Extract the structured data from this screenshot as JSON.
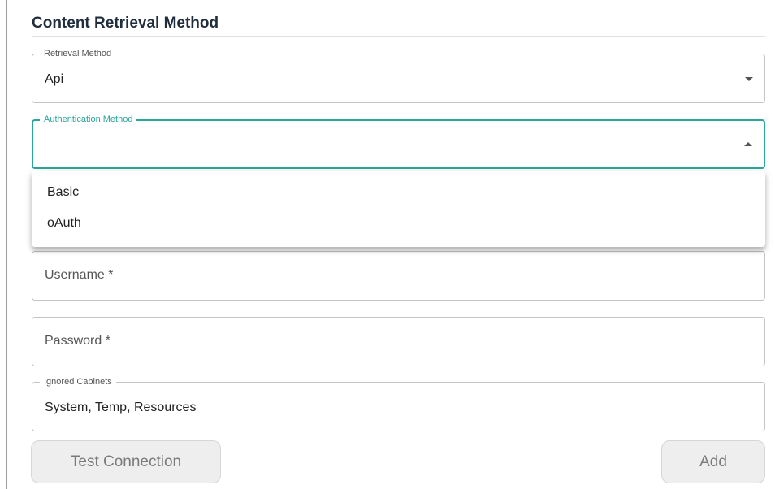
{
  "section": {
    "title": "Content Retrieval Method"
  },
  "retrieval_method": {
    "label": "Retrieval Method",
    "value": "Api"
  },
  "authentication_method": {
    "label": "Authentication Method",
    "value": "",
    "options": [
      "Basic",
      "oAuth"
    ]
  },
  "username": {
    "placeholder": "Username *"
  },
  "password": {
    "placeholder": "Password *"
  },
  "ignored_cabinets": {
    "label": "Ignored Cabinets",
    "value": "System, Temp, Resources"
  },
  "buttons": {
    "test_connection": "Test Connection",
    "add": "Add"
  },
  "colors": {
    "accent": "#2aa59a",
    "border": "#c4c4c4",
    "button_bg": "#eeeeee",
    "button_text": "#7a7a7a"
  }
}
